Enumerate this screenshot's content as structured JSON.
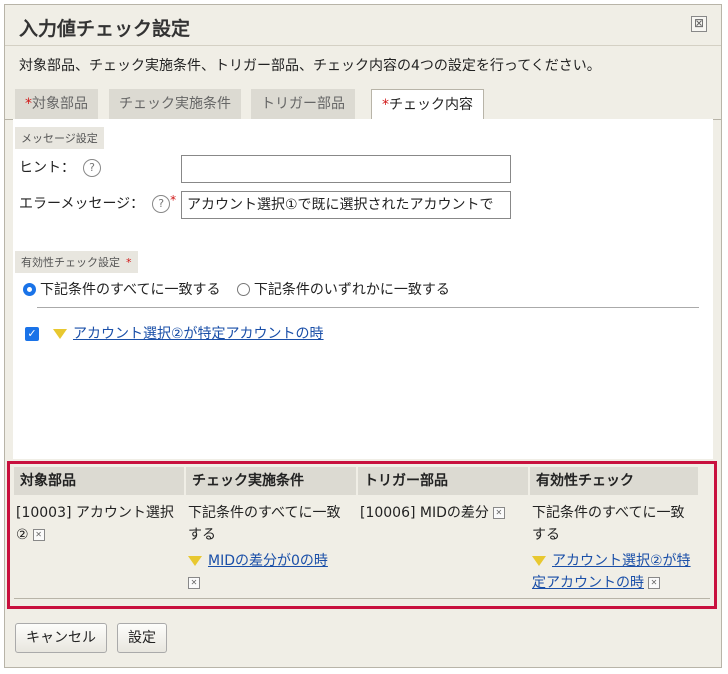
{
  "dialog": {
    "title": "入力値チェック設定",
    "close_symbol": "⊠",
    "description": "対象部品、チェック実施条件、トリガー部品、チェック内容の4つの設定を行ってください。"
  },
  "tabs": [
    {
      "req": "*",
      "label": "対象部品"
    },
    {
      "req": "",
      "label": "チェック実施条件"
    },
    {
      "req": "",
      "label": "トリガー部品"
    },
    {
      "req": "*",
      "label": "チェック内容"
    }
  ],
  "message_section": {
    "label": "メッセージ設定",
    "hint_label": "ヒント：",
    "hint_value": "",
    "error_label": "エラーメッセージ：",
    "error_value": "アカウント選択①で既に選択されたアカウントで",
    "help_symbol": "?",
    "required_mark": "*"
  },
  "validity_section": {
    "label": "有効性チェック設定",
    "required_mark": "*",
    "radio_all": "下記条件のすべてに一致する",
    "radio_any": "下記条件のいずれかに一致する",
    "condition_link": "アカウント選択②が特定アカウントの時"
  },
  "summary": {
    "headers": [
      "対象部品",
      "チェック実施条件",
      "トリガー部品",
      "有効性チェック"
    ],
    "target": "[10003] アカウント選択②",
    "condition_text": "下記条件のすべてに一致する",
    "condition_link": "MIDの差分が0の時",
    "trigger": "[10006] MIDの差分",
    "validity_text": "下記条件のすべてに一致する",
    "validity_link": "アカウント選択②が特定アカウントの時"
  },
  "footer": {
    "cancel": "キャンセル",
    "set": "設定"
  },
  "colors": {
    "accent": "#1a73e8",
    "highlight_border": "#c8103e",
    "required": "#d01616",
    "link": "#1a4fa8"
  }
}
